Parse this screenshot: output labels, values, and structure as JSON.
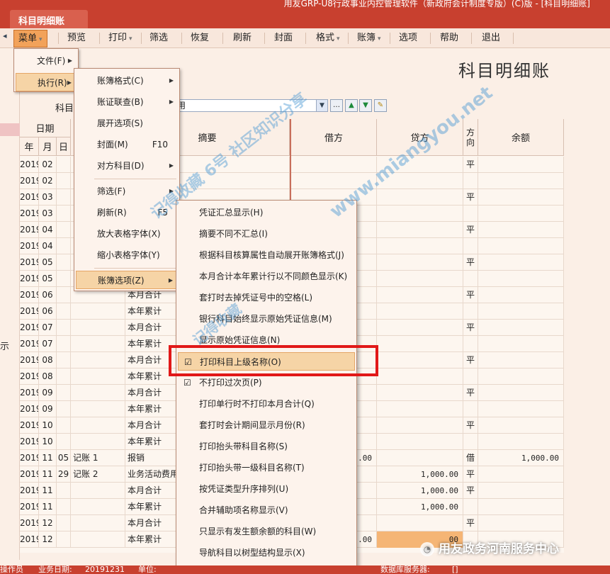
{
  "titlebar": {
    "tab": "科目明细账",
    "app_title": "用友GRP-U8行政事业内控管理软件（新政府会计制度专版）(C)版 - [科目明细账]"
  },
  "toolbar": {
    "left_arrow": "◂",
    "menu": "菜单",
    "preview": "预览",
    "print": "打印",
    "filter": "筛选",
    "restore": "恢复",
    "refresh": "刷新",
    "cover": "封面",
    "format": "格式",
    "ledger": "账簿",
    "options": "选项",
    "help": "帮助",
    "exit": "退出"
  },
  "report": {
    "title": "科目明细账",
    "subject_label": "科目",
    "subject_value": "用"
  },
  "grid_header": {
    "date": "日期",
    "year": "年",
    "month": "月",
    "day": "日",
    "summary": "摘要",
    "debit": "借方",
    "credit": "贷方",
    "direction": "方向",
    "balance": "余额"
  },
  "rows": [
    {
      "y": "2019",
      "m": "02",
      "d": "",
      "v": "",
      "s": "",
      "debit": "",
      "credit": "",
      "dir": "平",
      "bal": ""
    },
    {
      "y": "2019",
      "m": "02",
      "d": "",
      "v": "",
      "s": "",
      "debit": "",
      "credit": "",
      "dir": "",
      "bal": ""
    },
    {
      "y": "2019",
      "m": "03",
      "d": "",
      "v": "",
      "s": "",
      "debit": "",
      "credit": "",
      "dir": "平",
      "bal": ""
    },
    {
      "y": "2019",
      "m": "03",
      "d": "",
      "v": "",
      "s": "",
      "debit": "",
      "credit": "",
      "dir": "",
      "bal": ""
    },
    {
      "y": "2019",
      "m": "04",
      "d": "",
      "v": "",
      "s": "",
      "debit": "",
      "credit": "",
      "dir": "平",
      "bal": ""
    },
    {
      "y": "2019",
      "m": "04",
      "d": "",
      "v": "",
      "s": "",
      "debit": "",
      "credit": "",
      "dir": "",
      "bal": ""
    },
    {
      "y": "2019",
      "m": "05",
      "d": "",
      "v": "",
      "s": "",
      "debit": "",
      "credit": "",
      "dir": "平",
      "bal": ""
    },
    {
      "y": "2019",
      "m": "05",
      "d": "",
      "v": "",
      "s": "",
      "debit": "",
      "credit": "",
      "dir": "",
      "bal": ""
    },
    {
      "y": "2019",
      "m": "06",
      "d": "",
      "v": "",
      "s": "本月合计",
      "debit": "",
      "credit": "",
      "dir": "平",
      "bal": ""
    },
    {
      "y": "2019",
      "m": "06",
      "d": "",
      "v": "",
      "s": "本年累计",
      "debit": "",
      "credit": "",
      "dir": "",
      "bal": ""
    },
    {
      "y": "2019",
      "m": "07",
      "d": "",
      "v": "",
      "s": "本月合计",
      "debit": "",
      "credit": "",
      "dir": "平",
      "bal": ""
    },
    {
      "y": "2019",
      "m": "07",
      "d": "",
      "v": "",
      "s": "本年累计",
      "debit": "",
      "credit": "",
      "dir": "",
      "bal": ""
    },
    {
      "y": "2019",
      "m": "08",
      "d": "",
      "v": "",
      "s": "本月合计",
      "debit": "",
      "credit": "",
      "dir": "平",
      "bal": ""
    },
    {
      "y": "2019",
      "m": "08",
      "d": "",
      "v": "",
      "s": "本年累计",
      "debit": "",
      "credit": "",
      "dir": "",
      "bal": ""
    },
    {
      "y": "2019",
      "m": "09",
      "d": "",
      "v": "",
      "s": "本月合计",
      "debit": "",
      "credit": "",
      "dir": "平",
      "bal": ""
    },
    {
      "y": "2019",
      "m": "09",
      "d": "",
      "v": "",
      "s": "本年累计",
      "debit": "",
      "credit": "",
      "dir": "",
      "bal": ""
    },
    {
      "y": "2019",
      "m": "10",
      "d": "",
      "v": "",
      "s": "本月合计",
      "debit": "",
      "credit": "",
      "dir": "平",
      "bal": ""
    },
    {
      "y": "2019",
      "m": "10",
      "d": "",
      "v": "",
      "s": "本年累计",
      "debit": "",
      "credit": "",
      "dir": "",
      "bal": ""
    },
    {
      "y": "2019",
      "m": "11",
      "d": "05",
      "v": "记账 1",
      "s": "报销",
      "debit": ".00",
      "credit": "",
      "dir": "借",
      "bal": "1,000.00"
    },
    {
      "y": "2019",
      "m": "11",
      "d": "29",
      "v": "记账 2",
      "s": "业务活动费用",
      "debit": "",
      "credit": "1,000.00",
      "dir": "平",
      "bal": ""
    },
    {
      "y": "2019",
      "m": "11",
      "d": "",
      "v": "",
      "s": "本月合计",
      "debit": "",
      "credit": "1,000.00",
      "dir": "平",
      "bal": ""
    },
    {
      "y": "2019",
      "m": "11",
      "d": "",
      "v": "",
      "s": "本年累计",
      "debit": "",
      "credit": "1,000.00",
      "dir": "",
      "bal": ""
    },
    {
      "y": "2019",
      "m": "12",
      "d": "",
      "v": "",
      "s": "本月合计",
      "debit": "",
      "credit": "",
      "dir": "平",
      "bal": ""
    },
    {
      "y": "2019",
      "m": "12",
      "d": "",
      "v": "",
      "s": "本年累计",
      "debit": ".00",
      "credit": "00",
      "dir": "",
      "bal": ""
    }
  ],
  "menu_level1": {
    "file": "文件(F)",
    "execute": "执行(R)"
  },
  "menu_level2": {
    "book_format": "账簿格式(C)",
    "voucher_link": "账证联查(B)",
    "expand_options": "展开选项(S)",
    "cover": "封面(M)",
    "cover_shortcut": "F10",
    "contra_subject": "对方科目(D)",
    "filter": "筛选(F)",
    "refresh": "刷新(R)",
    "refresh_shortcut": "F5",
    "enlarge_font": "放大表格字体(X)",
    "shrink_font": "缩小表格字体(Y)",
    "book_options": "账簿选项(Z)"
  },
  "menu_level3": [
    {
      "label": "凭证汇总显示(H)",
      "checked": false
    },
    {
      "label": "摘要不同不汇总(I)",
      "checked": false
    },
    {
      "label": "根据科目核算属性自动展开账簿格式(J)",
      "checked": false
    },
    {
      "label": "本月合计本年累计行以不同颜色显示(K)",
      "checked": false
    },
    {
      "label": "套打时去掉凭证号中的空格(L)",
      "checked": false
    },
    {
      "label": "银行科目始终显示原始凭证信息(M)",
      "checked": false
    },
    {
      "label": "显示原始凭证信息(N)",
      "checked": false
    },
    {
      "label": "打印科目上级名称(O)",
      "checked": true
    },
    {
      "label": "不打印过次页(P)",
      "checked": true
    },
    {
      "label": "打印单行时不打印本月合计(Q)",
      "checked": false
    },
    {
      "label": "套打时会计期间显示月份(R)",
      "checked": false
    },
    {
      "label": "打印抬头带科目名称(S)",
      "checked": false
    },
    {
      "label": "打印抬头带一级科目名称(T)",
      "checked": false
    },
    {
      "label": "按凭证类型升序排列(U)",
      "checked": false
    },
    {
      "label": "合并辅助项名称显示(V)",
      "checked": false
    },
    {
      "label": "只显示有发生额余额的科目(W)",
      "checked": false
    },
    {
      "label": "导航科目以树型结构显示(X)",
      "checked": false
    }
  ],
  "watermark": {
    "line1": "记得收藏 6号 社区知识分享",
    "line2": "www.miangyou.net",
    "line3": "记得收藏"
  },
  "wechat_label": "用友政务河南服务中心",
  "statusbar": {
    "operator": "操作员",
    "business_date_label": "业务日期:",
    "business_date": "20191231",
    "unit_label": "单位:",
    "db_server_label": "数据库服务器:",
    "db_server": "[]"
  },
  "left_strip_char": "示",
  "colors": {
    "title_bar": "#c8402f",
    "menu_active": "#f2a25a",
    "highlight_box": "#e11818",
    "cell_highlight": "#f5b575"
  }
}
